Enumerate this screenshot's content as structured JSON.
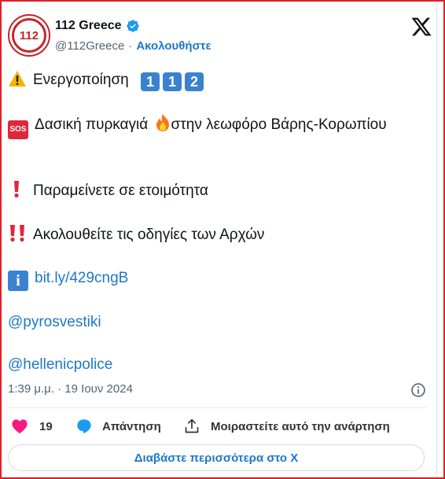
{
  "account": {
    "name": "112 Greece",
    "handle": "@112Greece",
    "separator": "·",
    "follow_label": "Ακολουθήστε",
    "avatar_text": "112"
  },
  "tweet": {
    "line1_text": "Ενεργοποίηση",
    "line1_digits": [
      "1",
      "1",
      "2"
    ],
    "line2_text": "Δασική πυρκαγιά",
    "line2_text_after": "στην λεωφόρο Βάρης-Κορωπίου",
    "sos_label": "SOS",
    "line3_text": "Παραμείνετε σε ετοιμότητα",
    "line4_text": "Ακολουθείτε τις οδηγίες των Αρχών",
    "link_text": "bit.ly/429cngB",
    "info_label": "i",
    "mention1": "@pyrosvestiki",
    "mention2": "@hellenicpolice"
  },
  "meta": {
    "timestamp": "1:39 μ.μ. · 19 Ιουν 2024"
  },
  "actions": {
    "likes_count": "19",
    "reply_label": "Απάντηση",
    "share_label": "Μοιραστείτε αυτό την ανάρτηση"
  },
  "read_more_label": "Διαβάστε περισσότερα στο X",
  "icons": {
    "verified": "verified-badge-icon",
    "x_logo": "x-logo-icon",
    "warning": "warning-icon",
    "fire": "fire-icon",
    "exclamation": "exclamation-icon",
    "double_exclamation": "double-exclamation-icon",
    "info": "info-icon",
    "heart": "heart-icon",
    "reply": "reply-icon",
    "share": "share-icon"
  },
  "colors": {
    "accent_blue": "#1d78c9",
    "heart_pink": "#f91880",
    "frame_red": "#e0202a",
    "brand_red": "#c4252b"
  }
}
